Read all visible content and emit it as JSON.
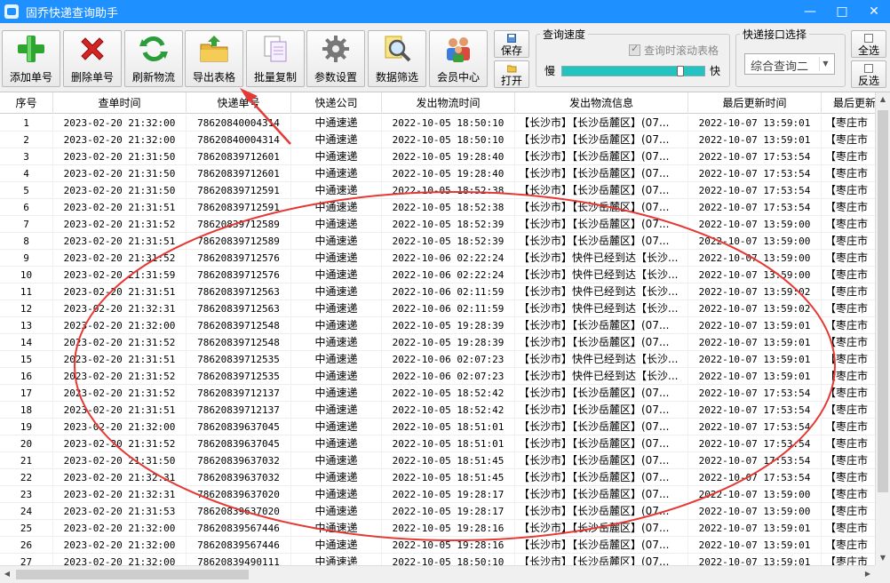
{
  "window": {
    "title": "固乔快递查询助手",
    "controls": [
      "—",
      "□",
      "✕"
    ]
  },
  "toolbar": {
    "buttons": [
      {
        "label": "添加单号",
        "icon": "plus-icon"
      },
      {
        "label": "删除单号",
        "icon": "delete-x-icon"
      },
      {
        "label": "刷新物流",
        "icon": "refresh-icon"
      },
      {
        "label": "导出表格",
        "icon": "folder-export-icon"
      },
      {
        "label": "批量复制",
        "icon": "copy-icon"
      },
      {
        "label": "参数设置",
        "icon": "gear-icon"
      },
      {
        "label": "数据筛选",
        "icon": "magnifier-icon"
      },
      {
        "label": "会员中心",
        "icon": "members-icon"
      }
    ],
    "save_label": "保存",
    "open_label": "打开",
    "select_all_label": "全选",
    "invert_label": "反选"
  },
  "speed": {
    "legend": "查询速度",
    "scroll_label": "查询时滚动表格",
    "slow_label": "慢",
    "fast_label": "快",
    "level": 0.85
  },
  "api": {
    "legend": "快递接口选择",
    "selected": "综合查询二"
  },
  "table": {
    "headers": [
      "序号",
      "查单时间",
      "快递单号",
      "快递公司",
      "发出物流时间",
      "发出物流信息",
      "最后更新时间",
      "最后更新"
    ],
    "rows": [
      [
        "1",
        "2023-02-20 21:32:00",
        "78620840004314",
        "中通速递",
        "2022-10-05 18:50:10",
        "【长沙市】【长沙岳麓区】(07...",
        "2022-10-07 13:59:01",
        "【枣庄市"
      ],
      [
        "2",
        "2023-02-20 21:32:00",
        "78620840004314",
        "中通速递",
        "2022-10-05 18:50:10",
        "【长沙市】【长沙岳麓区】(07...",
        "2022-10-07 13:59:01",
        "【枣庄市"
      ],
      [
        "3",
        "2023-02-20 21:31:50",
        "78620839712601",
        "中通速递",
        "2022-10-05 19:28:40",
        "【长沙市】【长沙岳麓区】(07...",
        "2022-10-07 17:53:54",
        "【枣庄市"
      ],
      [
        "4",
        "2023-02-20 21:31:50",
        "78620839712601",
        "中通速递",
        "2022-10-05 19:28:40",
        "【长沙市】【长沙岳麓区】(07...",
        "2022-10-07 17:53:54",
        "【枣庄市"
      ],
      [
        "5",
        "2023-02-20 21:31:50",
        "78620839712591",
        "中通速递",
        "2022-10-05 18:52:38",
        "【长沙市】【长沙岳麓区】(07...",
        "2022-10-07 17:53:54",
        "【枣庄市"
      ],
      [
        "6",
        "2023-02-20 21:31:51",
        "78620839712591",
        "中通速递",
        "2022-10-05 18:52:38",
        "【长沙市】【长沙岳麓区】(07...",
        "2022-10-07 17:53:54",
        "【枣庄市"
      ],
      [
        "7",
        "2023-02-20 21:31:52",
        "78620839712589",
        "中通速递",
        "2022-10-05 18:52:39",
        "【长沙市】【长沙岳麓区】(07...",
        "2022-10-07 13:59:00",
        "【枣庄市"
      ],
      [
        "8",
        "2023-02-20 21:31:51",
        "78620839712589",
        "中通速递",
        "2022-10-05 18:52:39",
        "【长沙市】【长沙岳麓区】(07...",
        "2022-10-07 13:59:00",
        "【枣庄市"
      ],
      [
        "9",
        "2023-02-20 21:31:52",
        "78620839712576",
        "中通速递",
        "2022-10-06 02:22:24",
        "【长沙市】快件已经到达【长沙...",
        "2022-10-07 13:59:00",
        "【枣庄市"
      ],
      [
        "10",
        "2023-02-20 21:31:59",
        "78620839712576",
        "中通速递",
        "2022-10-06 02:22:24",
        "【长沙市】快件已经到达【长沙...",
        "2022-10-07 13:59:00",
        "【枣庄市"
      ],
      [
        "11",
        "2023-02-20 21:31:51",
        "78620839712563",
        "中通速递",
        "2022-10-06 02:11:59",
        "【长沙市】快件已经到达【长沙...",
        "2022-10-07 13:59:02",
        "【枣庄市"
      ],
      [
        "12",
        "2023-02-20 21:32:31",
        "78620839712563",
        "中通速递",
        "2022-10-06 02:11:59",
        "【长沙市】快件已经到达【长沙...",
        "2022-10-07 13:59:02",
        "【枣庄市"
      ],
      [
        "13",
        "2023-02-20 21:32:00",
        "78620839712548",
        "中通速递",
        "2022-10-05 19:28:39",
        "【长沙市】【长沙岳麓区】(07...",
        "2022-10-07 13:59:01",
        "【枣庄市"
      ],
      [
        "14",
        "2023-02-20 21:31:52",
        "78620839712548",
        "中通速递",
        "2022-10-05 19:28:39",
        "【长沙市】【长沙岳麓区】(07...",
        "2022-10-07 13:59:01",
        "【枣庄市"
      ],
      [
        "15",
        "2023-02-20 21:31:51",
        "78620839712535",
        "中通速递",
        "2022-10-06 02:07:23",
        "【长沙市】快件已经到达【长沙...",
        "2022-10-07 13:59:01",
        "【枣庄市"
      ],
      [
        "16",
        "2023-02-20 21:31:52",
        "78620839712535",
        "中通速递",
        "2022-10-06 02:07:23",
        "【长沙市】快件已经到达【长沙...",
        "2022-10-07 13:59:01",
        "【枣庄市"
      ],
      [
        "17",
        "2023-02-20 21:31:52",
        "78620839712137",
        "中通速递",
        "2022-10-05 18:52:42",
        "【长沙市】【长沙岳麓区】(07...",
        "2022-10-07 17:53:54",
        "【枣庄市"
      ],
      [
        "18",
        "2023-02-20 21:31:51",
        "78620839712137",
        "中通速递",
        "2022-10-05 18:52:42",
        "【长沙市】【长沙岳麓区】(07...",
        "2022-10-07 17:53:54",
        "【枣庄市"
      ],
      [
        "19",
        "2023-02-20 21:32:00",
        "78620839637045",
        "中通速递",
        "2022-10-05 18:51:01",
        "【长沙市】【长沙岳麓区】(07...",
        "2022-10-07 17:53:54",
        "【枣庄市"
      ],
      [
        "20",
        "2023-02-20 21:31:52",
        "78620839637045",
        "中通速递",
        "2022-10-05 18:51:01",
        "【长沙市】【长沙岳麓区】(07...",
        "2022-10-07 17:53:54",
        "【枣庄市"
      ],
      [
        "21",
        "2023-02-20 21:31:50",
        "78620839637032",
        "中通速递",
        "2022-10-05 18:51:45",
        "【长沙市】【长沙岳麓区】(07...",
        "2022-10-07 17:53:54",
        "【枣庄市"
      ],
      [
        "22",
        "2023-02-20 21:32:31",
        "78620839637032",
        "中通速递",
        "2022-10-05 18:51:45",
        "【长沙市】【长沙岳麓区】(07...",
        "2022-10-07 17:53:54",
        "【枣庄市"
      ],
      [
        "23",
        "2023-02-20 21:32:31",
        "78620839637020",
        "中通速递",
        "2022-10-05 19:28:17",
        "【长沙市】【长沙岳麓区】(07...",
        "2022-10-07 13:59:00",
        "【枣庄市"
      ],
      [
        "24",
        "2023-02-20 21:31:53",
        "78620839637020",
        "中通速递",
        "2022-10-05 19:28:17",
        "【长沙市】【长沙岳麓区】(07...",
        "2022-10-07 13:59:00",
        "【枣庄市"
      ],
      [
        "25",
        "2023-02-20 21:32:00",
        "78620839567446",
        "中通速递",
        "2022-10-05 19:28:16",
        "【长沙市】【长沙岳麓区】(07...",
        "2022-10-07 13:59:01",
        "【枣庄市"
      ],
      [
        "26",
        "2023-02-20 21:32:00",
        "78620839567446",
        "中通速递",
        "2022-10-05 19:28:16",
        "【长沙市】【长沙岳麓区】(07...",
        "2022-10-07 13:59:01",
        "【枣庄市"
      ],
      [
        "27",
        "2023-02-20 21:32:00",
        "78620839490111",
        "中通速递",
        "2022-10-05 18:50:10",
        "【长沙市】【长沙岳麓区】(07...",
        "2022-10-07 13:59:01",
        "【枣庄市"
      ]
    ]
  },
  "colors": {
    "titlebar": "#1e90ff",
    "annotation": "#e53935",
    "slider": "#22c3c0"
  }
}
